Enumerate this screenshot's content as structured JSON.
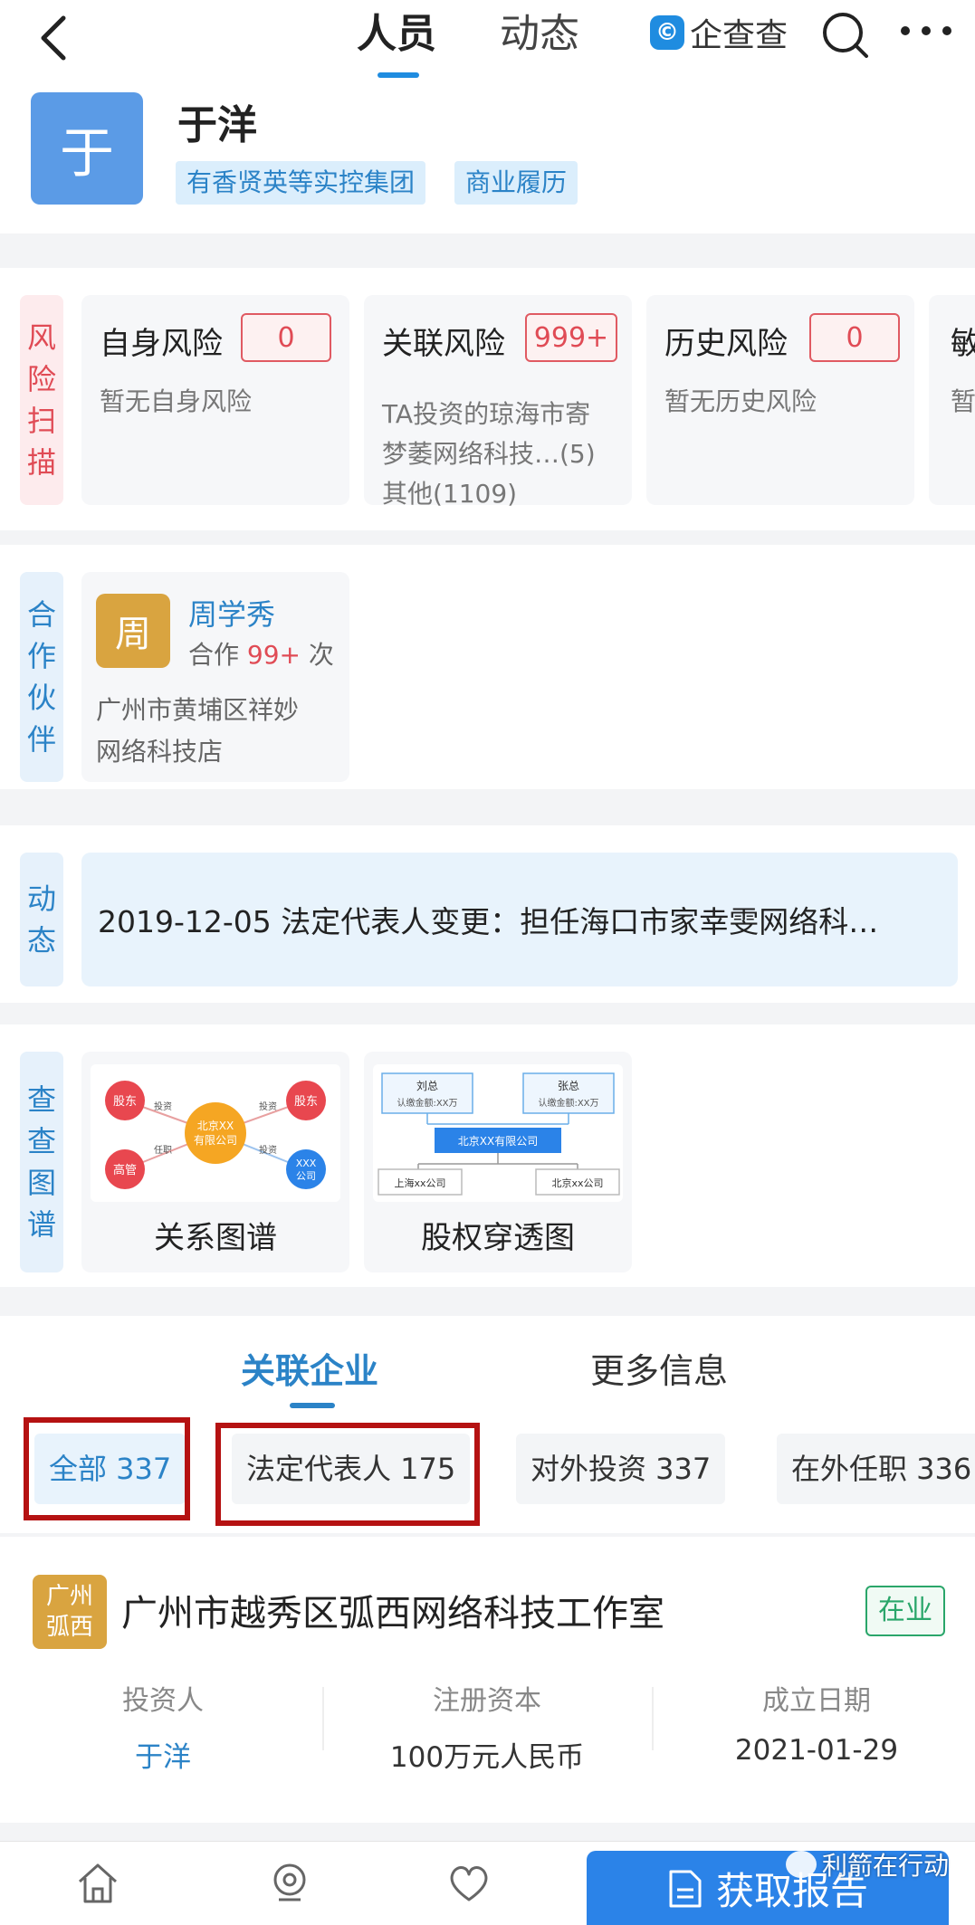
{
  "header": {
    "tabs": [
      "人员",
      "动态"
    ],
    "brand": "企查查",
    "brand_logo": "©"
  },
  "profile": {
    "avatar_char": "于",
    "name": "于洋",
    "tags": [
      "有香贤英等实控集团",
      "商业履历"
    ]
  },
  "risk": {
    "label": [
      "风",
      "险",
      "扫",
      "描"
    ],
    "cards": [
      {
        "title": "自身风险",
        "badge": "0",
        "desc": "暂无自身风险"
      },
      {
        "title": "关联风险",
        "badge": "999+",
        "desc_lines": [
          "TA投资的琼海市寄",
          "梦萎网络科技…(5)",
          "其他(1109)"
        ]
      },
      {
        "title": "历史风险",
        "badge": "0",
        "desc": "暂无历史风险"
      },
      {
        "title": "敏",
        "desc": "暂"
      }
    ]
  },
  "partner": {
    "label": [
      "合",
      "作",
      "伙",
      "伴"
    ],
    "avatar_char": "周",
    "name": "周学秀",
    "coop_prefix": "合作",
    "coop_count": "99+",
    "coop_suffix": "次",
    "company_lines": [
      "广州市黄埔区祥妙",
      "网络科技店"
    ]
  },
  "news": {
    "label": [
      "动",
      "态"
    ],
    "text": "2019-12-05 法定代表人变更：担任海口市家幸雯网络科…"
  },
  "graphs": {
    "label": [
      "查",
      "查",
      "图",
      "谱"
    ],
    "items": [
      {
        "title": "关系图谱",
        "center": "北京XX\n有限公司",
        "nodes": [
          "股东",
          "股东",
          "高管",
          "XXX\n公司"
        ],
        "edges": [
          "投资",
          "投资",
          "任职",
          "投资"
        ]
      },
      {
        "title": "股权穿透图",
        "top": [
          {
            "name": "刘总",
            "amount": "认缴金额:XX万"
          },
          {
            "name": "张总",
            "amount": "认缴金额:XX万"
          }
        ],
        "center": "北京XX有限公司",
        "bottom": [
          "上海xx公司",
          "北京xx公司"
        ]
      }
    ]
  },
  "lower": {
    "tabs": [
      "关联企业",
      "更多信息"
    ],
    "chips": [
      "全部 337",
      "法定代表人 175",
      "对外投资 337",
      "在外任职 336"
    ],
    "company": {
      "badge_lines": [
        "广州",
        "弧西"
      ],
      "name": "广州市越秀区弧西网络科技工作室",
      "status": "在业",
      "columns": [
        {
          "label": "投资人",
          "value": "于洋"
        },
        {
          "label": "注册资本",
          "value": "100万元人民币"
        },
        {
          "label": "成立日期",
          "value": "2021-01-29"
        }
      ]
    }
  },
  "bottom": {
    "icons": [
      "home-icon",
      "camera-icon",
      "heart-icon"
    ],
    "report_label": "获取报告",
    "watermark": "利箭在行动"
  },
  "colors": {
    "accent": "#2b83c7",
    "risk_red": "#e04b55",
    "status_green": "#2aa66a",
    "highlight_box": "#b51212"
  }
}
